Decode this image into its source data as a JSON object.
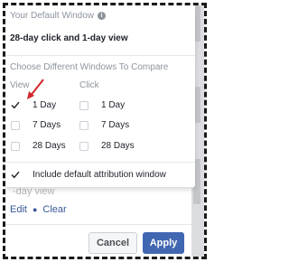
{
  "popover": {
    "heading": "Your Default Window",
    "default_window": "28-day click and 1-day view",
    "compare_heading": "Choose Different Windows To Compare",
    "view_column": {
      "label": "View",
      "options": [
        {
          "label": "1 Day",
          "checked": true
        },
        {
          "label": "7 Days",
          "checked": false
        },
        {
          "label": "28 Days",
          "checked": false
        }
      ]
    },
    "click_column": {
      "label": "Click",
      "options": [
        {
          "label": "1 Day",
          "checked": false
        },
        {
          "label": "7 Days",
          "checked": false
        },
        {
          "label": "28 Days",
          "checked": false
        }
      ]
    },
    "include_default": {
      "label": "Include default attribution window",
      "checked": true
    }
  },
  "background": {
    "partial_text": "-day view",
    "edit_link": "Edit",
    "clear_link": "Clear"
  },
  "footer": {
    "cancel_label": "Cancel",
    "apply_label": "Apply"
  },
  "colors": {
    "apply_button": "#4267b2",
    "annotation_arrow": "#d0262b",
    "muted_text": "#8d949e"
  }
}
